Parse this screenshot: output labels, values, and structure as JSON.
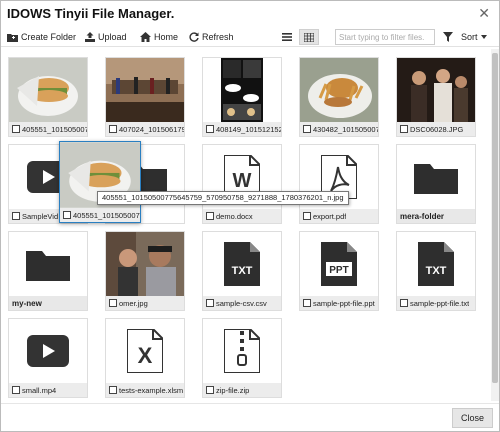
{
  "window": {
    "title": "IDOWS Tinyii File Manager.",
    "close_glyph": "✕"
  },
  "toolbar": {
    "create_folder_label": "Create Folder",
    "upload_label": "Upload",
    "home_label": "Home",
    "refresh_label": "Refresh",
    "filter_placeholder": "Start typing to filter files.",
    "sort_label": "Sort"
  },
  "files": [
    {
      "name": "405551_101505007",
      "kind": "image",
      "thumb": "burger"
    },
    {
      "name": "407024_101506179",
      "kind": "image",
      "thumb": "stage"
    },
    {
      "name": "408149_101512152",
      "kind": "image",
      "thumb": "comic"
    },
    {
      "name": "430482_101505007",
      "kind": "image",
      "thumb": "fries"
    },
    {
      "name": "DSC06028.JPG",
      "kind": "image",
      "thumb": "people"
    },
    {
      "name": "SampleVid",
      "kind": "video"
    },
    {
      "name": "",
      "kind": "hidden"
    },
    {
      "name": "demo.docx",
      "kind": "docx"
    },
    {
      "name": "export.pdf",
      "kind": "pdf"
    },
    {
      "name": "mera-folder",
      "kind": "folder"
    },
    {
      "name": "my-new",
      "kind": "folder"
    },
    {
      "name": "omer.jpg",
      "kind": "image",
      "thumb": "omer"
    },
    {
      "name": "sample-csv.csv",
      "kind": "txt"
    },
    {
      "name": "sample-ppt-file.ppt",
      "kind": "ppt"
    },
    {
      "name": "sample-ppt-file.txt",
      "kind": "txt"
    },
    {
      "name": "small.mp4",
      "kind": "video"
    },
    {
      "name": "tests-example.xlsm",
      "kind": "xls"
    },
    {
      "name": "zip-file.zip",
      "kind": "zip"
    }
  ],
  "drag": {
    "name": "405551_101505007",
    "tooltip": "405551_10150500775645759_570950758_9271888_1780376201_n.jpg"
  },
  "icons": {
    "create_folder": "folder-plus-icon",
    "upload": "upload-icon",
    "home": "home-icon",
    "refresh": "refresh-icon",
    "list_view": "list-icon",
    "grid_view": "grid-icon",
    "filter": "filter-icon"
  },
  "footer": {
    "close_label": "Close"
  }
}
